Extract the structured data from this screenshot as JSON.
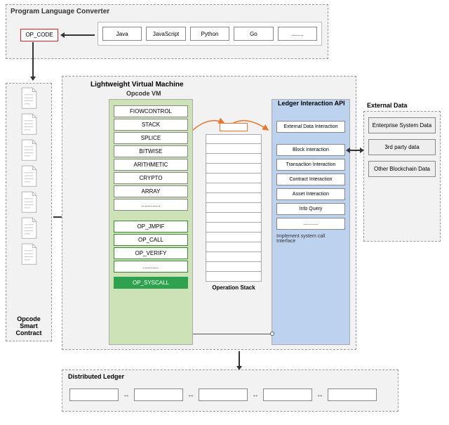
{
  "converter": {
    "title": "Program Language Converter",
    "opcode": "OP_CODE",
    "langs": [
      "Java",
      "JavaScript",
      "Python",
      "Go",
      "........"
    ]
  },
  "osc": {
    "caption": "Opcode Smart Contract",
    "iconCount": 7
  },
  "vm": {
    "title": "Lightweight Virtual Machine"
  },
  "opvm": {
    "title": "Opcode VM",
    "categories": [
      "FIOWCONTROL",
      "STACK",
      "SPLICE",
      "BITWISE",
      "ARITHMETIC",
      "CRYPTO",
      "ARRAY",
      "............"
    ],
    "ops": [
      "OP_JMPIF",
      "OP_CALL",
      "OP_VERIFY",
      ".........."
    ],
    "syscall": "OP_SYSCALL"
  },
  "opstack": {
    "caption": "Operation Stack",
    "rows": 15
  },
  "ledger_api": {
    "title": "Ledger Interaction API",
    "ext": "External Data Interaction",
    "items": [
      "Block Interaction",
      "Transaction Interaction",
      "Contract Interaction",
      "Asset Interaction",
      "Info Query",
      "..........."
    ],
    "note": "Implement system call Interface"
  },
  "external": {
    "title": "External Data",
    "items": [
      "Enterprise System Data",
      "3rd party data",
      "Other Blockchain Data"
    ]
  },
  "dl": {
    "title": "Distributed Ledger",
    "blocks": 5
  }
}
